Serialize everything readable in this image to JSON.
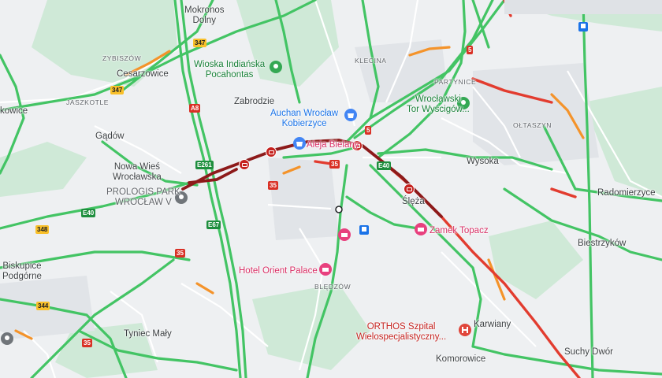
{
  "labels": {
    "mokronos": "Mokronos\nDolny",
    "zybiszow": "ZYBISZÓW",
    "wioska": "Wioska Indiańska\nPocahontas",
    "klecina": "KLECINA",
    "partynice": "PARTYNICE",
    "cesarzowice": "Cesarzowice",
    "jaszkotle": "JASZKOTLE",
    "zabrodzie": "Zabrodzie",
    "auchan": "Auchan Wrocław\nKobierzyce",
    "tor": "Wrocławski\nTor Wyścigów...",
    "oltaszyn": "OŁTASZYN",
    "kowice": "kowice",
    "gadow": "Gądów",
    "aleja": "Aleja Bielany",
    "wysoka": "Wysoka",
    "nowawies": "Nowa Wieś\nWrocławska",
    "prologis": "PROLOGIS PARK\nWROCŁAW V",
    "radomierzyce": "Radomierzyce",
    "sleza": "Ślęża",
    "zamek": "Zamek Topacz",
    "biestrzykow": "Biestrzyków",
    "biskupice": "Biskupice\nPodgórne",
    "orient": "Hotel Orient Palace",
    "bledzow": "BLĘDZÓW",
    "tyniec": "Tyniec Mały",
    "orthos": "ORTHOS Szpital\nWielospecjalistyczny...",
    "karwiany": "Karwiany",
    "suchy": "Suchy Dwór",
    "komorowice": "Komorowice"
  },
  "shields": {
    "s347a": "347",
    "s347b": "347",
    "a8": "A8",
    "s5a": "5",
    "s5b": "5",
    "e261": "E261",
    "s35a": "35",
    "s35b": "35",
    "s35c": "35",
    "s35d": "35",
    "e40a": "E40",
    "e40b": "E40",
    "e67": "E67",
    "s348": "348",
    "s344": "344"
  },
  "colors": {
    "traffic_free": "#43c464",
    "traffic_slow": "#f4932a",
    "traffic_jam": "#e23c2f",
    "traffic_heavy": "#8d1a1a",
    "park": "#cfe9d7",
    "urban": "#e3e6ea"
  },
  "icons": {
    "place_pin": "green-pin-icon",
    "shopping_pin": "shopping-bag-pin-icon",
    "hotel_pin": "hotel-bed-pin-icon",
    "hospital_pin": "hospital-pin-icon",
    "incident": "crash-incident-icon",
    "bus": "bus-stop-icon"
  }
}
